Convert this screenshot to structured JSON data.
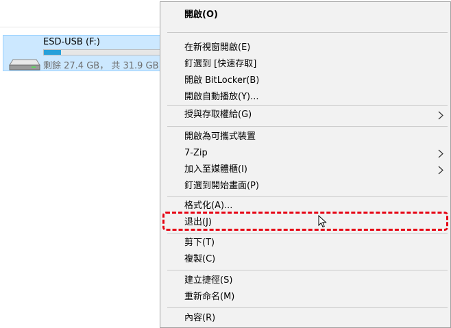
{
  "drive": {
    "name": "ESD-USB (F:)",
    "free_text": "剩餘 27.4 GB， 共 31.9 GB",
    "used_fraction": 0.14,
    "icon": "usb-drive-icon"
  },
  "context_menu": {
    "open_default": "開啟(O)",
    "open_new_window": "在新視窗開啟(E)",
    "pin_quick_access": "釘選到 [快速存取]",
    "open_bitlocker": "開啟 BitLocker(B)",
    "autoplay": "開啟自動播放(Y)...",
    "give_access": "授與存取權給(G)",
    "open_portable": "開啟為可攜式裝置",
    "seven_zip": "7-Zip",
    "add_library": "加入至媒體櫃(I)",
    "pin_start": "釘選到開始畫面(P)",
    "format": "格式化(A)...",
    "eject": "退出(J)",
    "cut": "剪下(T)",
    "copy": "複製(C)",
    "create_shortcut": "建立捷徑(S)",
    "rename": "重新命名(M)",
    "properties": "內容(R)"
  },
  "colors": {
    "selection_bg": "#cce8ff",
    "progress_fill": "#26a0da",
    "highlight_border": "#e60012",
    "menu_bg": "#f2f2f2"
  }
}
